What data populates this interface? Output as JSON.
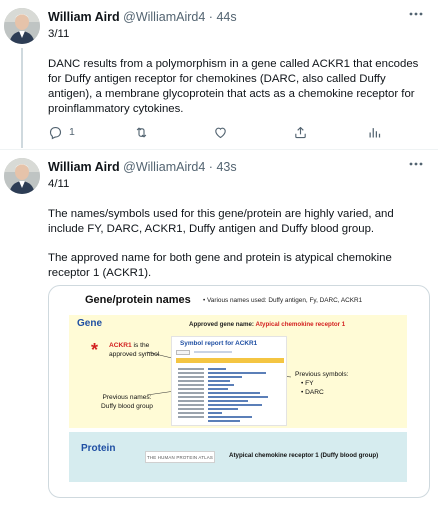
{
  "tweets": [
    {
      "author_name": "William Aird",
      "author_handle": "@WilliamAird4",
      "separator": "·",
      "time": "44s",
      "counter": "3/11",
      "body": "DANC results from a polymorphism in a gene called ACKR1 that encodes for Duffy antigen receptor for chemokines (DARC, also called Duffy antigen), a membrane glycoprotein that acts as a chemokine receptor for proinflammatory cytokines.",
      "reply_count": "1",
      "retweet_count": "",
      "like_count": "",
      "views_count": ""
    },
    {
      "author_name": "William Aird",
      "author_handle": "@WilliamAird4",
      "separator": "·",
      "time": "43s",
      "counter": "4/11",
      "body_p1": "The names/symbols used for this gene/protein are highly varied, and include FY, DARC, ACKR1, Duffy antigen and Duffy blood group.",
      "body_p2": "The approved name for both gene and protein is atypical chemokine receptor 1 (ACKR1)."
    }
  ],
  "media": {
    "title": "Gene/protein names",
    "various": "• Various names used: Duffy antigen, Fy,  DARC, ACKR1",
    "gene_label": "Gene",
    "approved_prefix": "Approved gene name: ",
    "approved_value": "Atypical chemokine receptor 1",
    "asterisk": "*",
    "ackr1_symbol": "ACKR1",
    "ackr1_is_the": " is the",
    "approved_symbol": "approved symbol",
    "previous_names_1": "Previous names:",
    "previous_names_2": "Duffy blood group",
    "report_title": "Symbol report for ACKR1",
    "previous_symbols_title": "Previous symbols:",
    "previous_symbols": [
      "FY",
      "DARC"
    ],
    "protein_label": "Protein",
    "hpa_logo_text": "THE HUMAN PROTEIN ATLAS",
    "protein_name": "Atypical chemokine receptor 1 (Duffy blood group)"
  },
  "icons": {
    "more": "more-horizontal-icon",
    "reply": "reply-icon",
    "retweet": "retweet-icon",
    "like": "heart-icon",
    "share": "share-icon",
    "views": "analytics-icon"
  },
  "colors": {
    "text": "#0f1419",
    "secondary": "#536471",
    "border": "#cfd9de",
    "gene_band": "#fffbd6",
    "protein_band": "#d6ecef",
    "accent_red": "#d31f1f",
    "accent_blue": "#1f4fa3"
  }
}
